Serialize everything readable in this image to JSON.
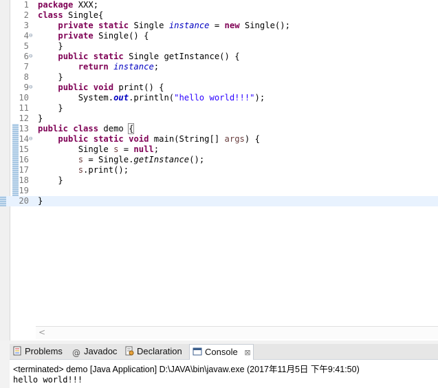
{
  "editor": {
    "lines": [
      {
        "n": "1",
        "fold": "",
        "segs": [
          {
            "t": "package",
            "c": "kw"
          },
          {
            "t": " XXX;",
            "c": ""
          }
        ]
      },
      {
        "n": "2",
        "fold": "",
        "segs": [
          {
            "t": "class",
            "c": "kw"
          },
          {
            "t": " Single{",
            "c": ""
          }
        ]
      },
      {
        "n": "3",
        "fold": "",
        "segs": [
          {
            "t": "    ",
            "c": ""
          },
          {
            "t": "private",
            "c": "kw"
          },
          {
            "t": " ",
            "c": ""
          },
          {
            "t": "static",
            "c": "kw"
          },
          {
            "t": " Single ",
            "c": ""
          },
          {
            "t": "instance",
            "c": "fld"
          },
          {
            "t": " = ",
            "c": ""
          },
          {
            "t": "new",
            "c": "kw"
          },
          {
            "t": " Single();",
            "c": ""
          }
        ]
      },
      {
        "n": "4",
        "fold": "⊖",
        "segs": [
          {
            "t": "    ",
            "c": ""
          },
          {
            "t": "private",
            "c": "kw"
          },
          {
            "t": " Single() {",
            "c": ""
          }
        ]
      },
      {
        "n": "5",
        "fold": "",
        "segs": [
          {
            "t": "    }",
            "c": ""
          }
        ]
      },
      {
        "n": "6",
        "fold": "⊖",
        "segs": [
          {
            "t": "    ",
            "c": ""
          },
          {
            "t": "public",
            "c": "kw"
          },
          {
            "t": " ",
            "c": ""
          },
          {
            "t": "static",
            "c": "kw"
          },
          {
            "t": " Single getInstance() {",
            "c": ""
          }
        ]
      },
      {
        "n": "7",
        "fold": "",
        "segs": [
          {
            "t": "        ",
            "c": ""
          },
          {
            "t": "return",
            "c": "kw"
          },
          {
            "t": " ",
            "c": ""
          },
          {
            "t": "instance",
            "c": "fld"
          },
          {
            "t": ";",
            "c": ""
          }
        ]
      },
      {
        "n": "8",
        "fold": "",
        "segs": [
          {
            "t": "    }",
            "c": ""
          }
        ]
      },
      {
        "n": "9",
        "fold": "⊖",
        "segs": [
          {
            "t": "    ",
            "c": ""
          },
          {
            "t": "public",
            "c": "kw"
          },
          {
            "t": " ",
            "c": ""
          },
          {
            "t": "void",
            "c": "kw"
          },
          {
            "t": " print() {",
            "c": ""
          }
        ]
      },
      {
        "n": "10",
        "fold": "",
        "segs": [
          {
            "t": "        System.",
            "c": ""
          },
          {
            "t": "out",
            "c": "out"
          },
          {
            "t": ".println(",
            "c": ""
          },
          {
            "t": "\"hello world!!!\"",
            "c": "str"
          },
          {
            "t": ");",
            "c": ""
          }
        ]
      },
      {
        "n": "11",
        "fold": "",
        "segs": [
          {
            "t": "    }",
            "c": ""
          }
        ]
      },
      {
        "n": "12",
        "fold": "",
        "segs": [
          {
            "t": "}",
            "c": ""
          }
        ]
      },
      {
        "n": "13",
        "fold": "",
        "qd": true,
        "segs": [
          {
            "t": "public",
            "c": "kw"
          },
          {
            "t": " ",
            "c": ""
          },
          {
            "t": "class",
            "c": "kw"
          },
          {
            "t": " demo ",
            "c": ""
          },
          {
            "t": "{",
            "c": "brk"
          }
        ]
      },
      {
        "n": "14",
        "fold": "⊖",
        "qd": true,
        "segs": [
          {
            "t": "    ",
            "c": ""
          },
          {
            "t": "public",
            "c": "kw"
          },
          {
            "t": " ",
            "c": ""
          },
          {
            "t": "static",
            "c": "kw"
          },
          {
            "t": " ",
            "c": ""
          },
          {
            "t": "void",
            "c": "kw"
          },
          {
            "t": " main(String[] ",
            "c": ""
          },
          {
            "t": "args",
            "c": "par"
          },
          {
            "t": ") {",
            "c": ""
          }
        ]
      },
      {
        "n": "15",
        "fold": "",
        "qd": true,
        "segs": [
          {
            "t": "        Single ",
            "c": ""
          },
          {
            "t": "s",
            "c": "par"
          },
          {
            "t": " = ",
            "c": ""
          },
          {
            "t": "null",
            "c": "kw"
          },
          {
            "t": ";",
            "c": ""
          }
        ]
      },
      {
        "n": "16",
        "fold": "",
        "qd": true,
        "segs": [
          {
            "t": "        ",
            "c": ""
          },
          {
            "t": "s",
            "c": "par"
          },
          {
            "t": " = Single.",
            "c": ""
          },
          {
            "t": "getInstance",
            "c": "sm"
          },
          {
            "t": "();",
            "c": ""
          }
        ]
      },
      {
        "n": "17",
        "fold": "",
        "qd": true,
        "segs": [
          {
            "t": "        ",
            "c": ""
          },
          {
            "t": "s",
            "c": "par"
          },
          {
            "t": ".print();",
            "c": ""
          }
        ]
      },
      {
        "n": "18",
        "fold": "",
        "qd": true,
        "segs": [
          {
            "t": "    }",
            "c": ""
          }
        ]
      },
      {
        "n": "19",
        "fold": "",
        "qd": true,
        "segs": []
      },
      {
        "n": "20",
        "fold": "",
        "qd": true,
        "current": true,
        "segs": [
          {
            "t": "}",
            "c": ""
          }
        ]
      }
    ]
  },
  "scrollbar": {
    "left_arrow": "<"
  },
  "tabs": [
    {
      "label": "Problems",
      "icon": "problems-icon",
      "active": false
    },
    {
      "label": "Javadoc",
      "icon": "javadoc-icon",
      "active": false
    },
    {
      "label": "Declaration",
      "icon": "declaration-icon",
      "active": false
    },
    {
      "label": "Console",
      "icon": "console-icon",
      "active": true,
      "close": "⊠"
    }
  ],
  "console": {
    "status": "<terminated> demo [Java Application] D:\\JAVA\\bin\\javaw.exe (2017年11月5日 下午9:41:50)",
    "output": "hello world!!!"
  },
  "colors": {
    "keyword": "#7f0055",
    "field": "#0000c0",
    "string": "#2a00ff",
    "current_line": "#e8f2fe"
  }
}
